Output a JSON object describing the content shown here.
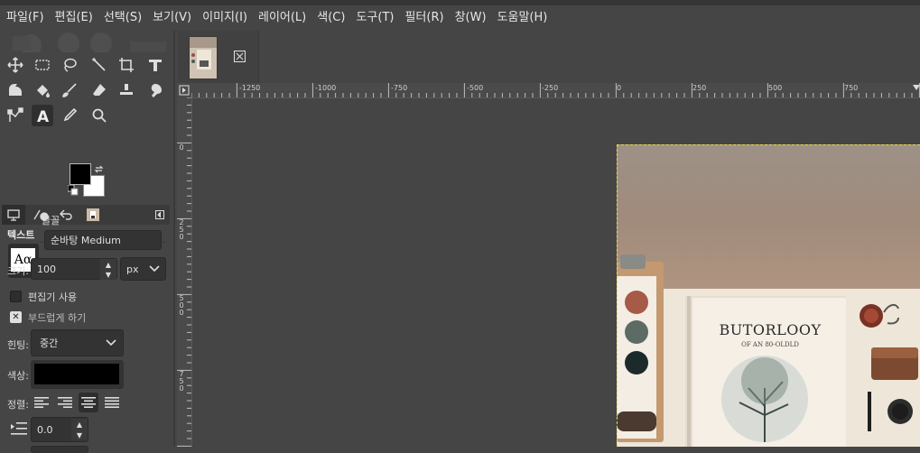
{
  "menu": [
    "파일(F)",
    "편집(E)",
    "선택(S)",
    "보기(V)",
    "이미지(I)",
    "레이어(L)",
    "색(C)",
    "도구(T)",
    "필터(R)",
    "창(W)",
    "도움말(H)"
  ],
  "tools": [
    "move-tool-icon",
    "rect-select-tool-icon",
    "lasso-tool-icon",
    "fuzzy-select-tool-icon",
    "crop-tool-icon",
    "transform-tool-icon",
    "warp-tool-icon",
    "bucket-fill-tool-icon",
    "paintbrush-tool-icon",
    "eraser-tool-icon",
    "clone-tool-icon",
    "smudge-tool-icon",
    "paths-tool-icon",
    "text-tool-icon",
    "color-picker-tool-icon",
    "zoom-tool-icon"
  ],
  "colors": {
    "foreground": "#000000",
    "background": "#ffffff"
  },
  "tool_options": {
    "title": "텍스트",
    "font_label": "글꼴",
    "font_preview": "Aα",
    "font_value": "순바탕 Medium",
    "size_label": "크기:",
    "size_value": "100",
    "size_unit": "px",
    "use_editor_label": "편집기 사용",
    "use_editor_checked": false,
    "antialias_label": "부드럽게 하기",
    "antialias_checked": true,
    "hinting_label": "힌팅:",
    "hinting_value": "중간",
    "color_label": "색상:",
    "color_value": "#000000",
    "justify_label": "정렬:",
    "indent_value": "0.0"
  },
  "ruler_h_labels": [
    "-1250",
    "-1000",
    "-750",
    "-500",
    "-250",
    "0",
    "250",
    "500",
    "750"
  ],
  "ruler_v_labels": [
    "0",
    "250",
    "500",
    "750"
  ],
  "image": {
    "book_title": "BUTORLOOY",
    "book_subtitle": "OF AN 80-OLDLD"
  }
}
